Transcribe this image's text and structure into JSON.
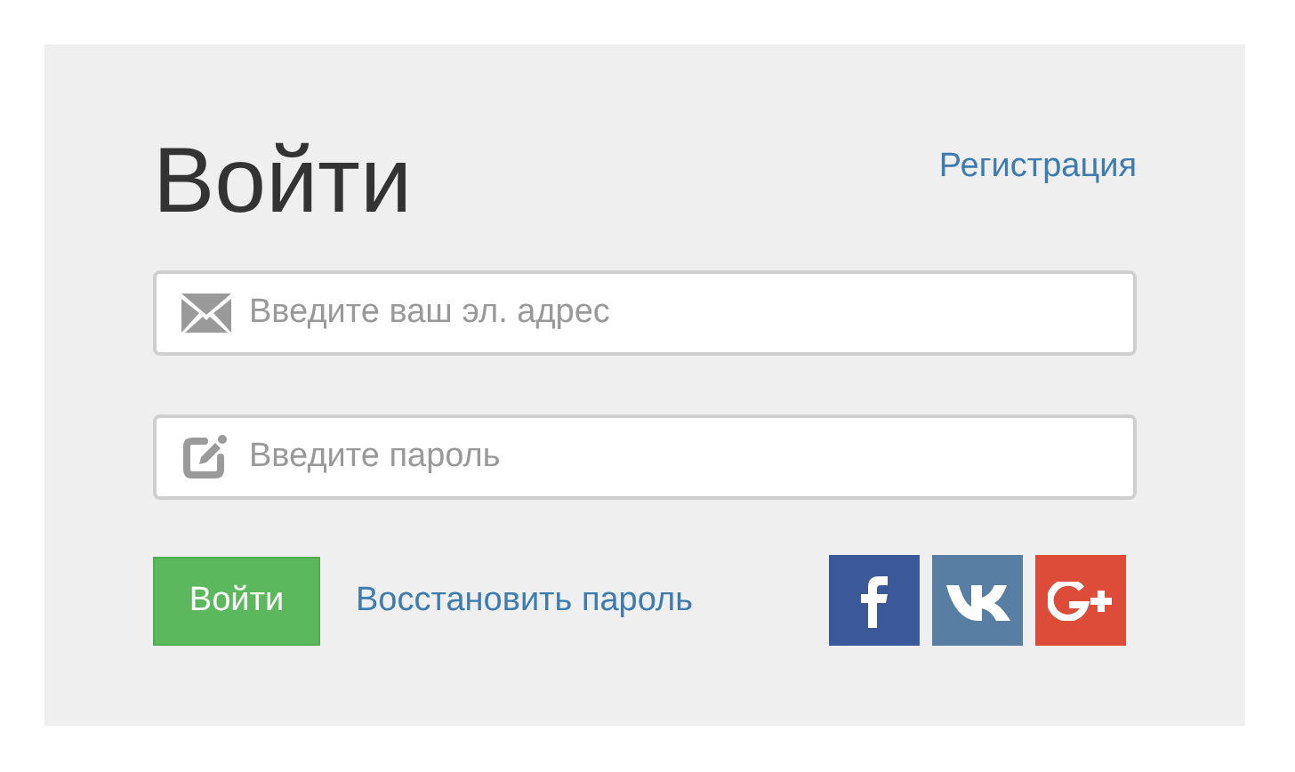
{
  "title": "Войти",
  "register_link": "Регистрация",
  "fields": [
    {
      "kind": "email",
      "placeholder": "Введите ваш эл. адрес"
    },
    {
      "kind": "password",
      "placeholder": "Введите пароль"
    }
  ],
  "login_button": "Войти",
  "restore_link": "Восстановить пароль",
  "social": [
    {
      "kind": "facebook",
      "color": "#3b5998"
    },
    {
      "kind": "vk",
      "color": "#587ea3"
    },
    {
      "kind": "google-plus",
      "color": "#dd4b39"
    }
  ]
}
